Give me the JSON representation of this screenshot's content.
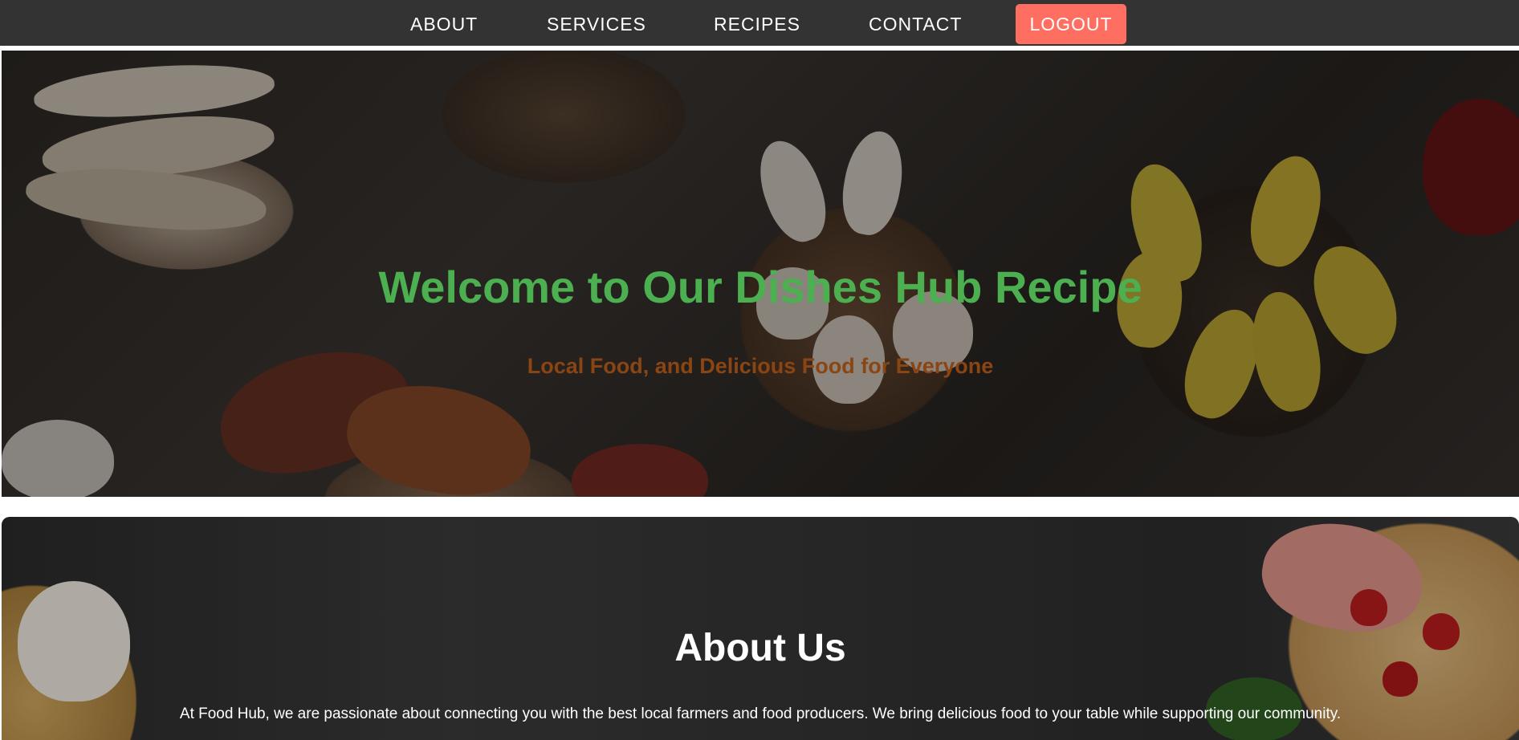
{
  "nav": {
    "links": [
      {
        "label": "ABOUT"
      },
      {
        "label": "SERVICES"
      },
      {
        "label": "RECIPES"
      },
      {
        "label": "CONTACT"
      }
    ],
    "logout_label": "LOGOUT"
  },
  "hero": {
    "title": "Welcome to Our Dishes Hub Recipe",
    "subtitle": "Local Food, and Delicious Food for Everyone"
  },
  "about": {
    "title": "About Us",
    "text": "At Food Hub, we are passionate about connecting you with the best local farmers and food producers. We bring delicious food to your table while supporting our community."
  },
  "colors": {
    "nav_bg": "#333333",
    "logout_bg": "#ff6f61",
    "hero_title": "#4caf50",
    "hero_subtitle": "#8b4513"
  }
}
